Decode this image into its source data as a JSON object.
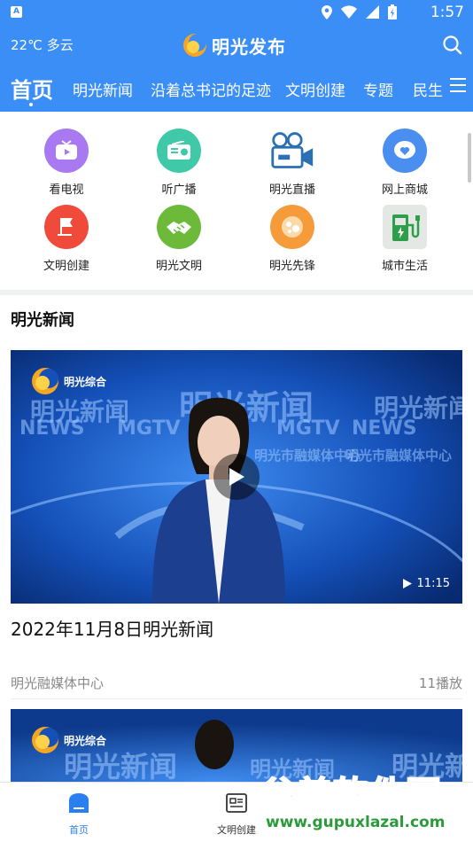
{
  "status_bar": {
    "time": "1:57"
  },
  "header": {
    "weather": "22℃ 多云",
    "title": "明光发布"
  },
  "tabs": [
    "首页",
    "明光新闻",
    "沿着总书记的足迹",
    "文明创建",
    "专题",
    "民生"
  ],
  "grid": [
    {
      "label": "看电视",
      "icon": "tv-icon",
      "color": "#a879f0"
    },
    {
      "label": "听广播",
      "icon": "radio-icon",
      "color": "#3fc9a8"
    },
    {
      "label": "明光直播",
      "icon": "camera-icon",
      "color": "#2b6fb5"
    },
    {
      "label": "网上商城",
      "icon": "shop-icon",
      "color": "#4a8ff0"
    },
    {
      "label": "文明创建",
      "icon": "flag-icon",
      "color": "#f04a3a"
    },
    {
      "label": "明光文明",
      "icon": "handshake-icon",
      "color": "#6dba3a"
    },
    {
      "label": "明光先锋",
      "icon": "pioneer-icon",
      "color": "#f59b3a"
    },
    {
      "label": "城市生活",
      "icon": "charging-icon",
      "color": "#2e9e4a"
    }
  ],
  "section": {
    "title": "明光新闻"
  },
  "video": {
    "channel": "明光综合",
    "bg_big": "明光新闻",
    "bg_news": "NEWS",
    "bg_mgtv": "MGTV",
    "bg_center": "明光市融媒体中心",
    "duration": "11:15"
  },
  "news": {
    "title": "2022年11月8日明光新闻",
    "source": "明光融媒体中心",
    "plays": "11播放"
  },
  "bottom_nav": [
    "首页",
    "文明创建"
  ],
  "watermark": {
    "brand": "谷普软件园",
    "url": "www.gupuxlazal.com"
  },
  "colors": {
    "brand_blue": "#3a8ef5",
    "nav_active": "#2a7ff0"
  }
}
